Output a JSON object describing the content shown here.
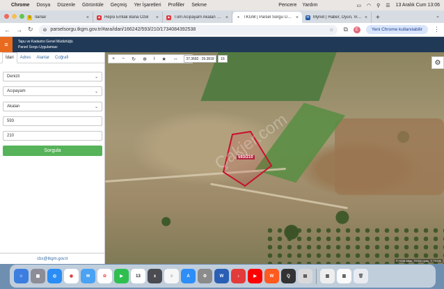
{
  "menubar": {
    "app": "Chrome",
    "items": [
      "Dosya",
      "Düzenle",
      "Görüntüle",
      "Geçmiş",
      "Yer İşaretleri",
      "Profiller",
      "Sekme"
    ],
    "right_items": [
      "Pencere",
      "Yardım"
    ],
    "datetime": "13 Aralık Cum 13:06"
  },
  "tabs": [
    {
      "title": "İlanlar",
      "fav_text": "S",
      "fav_color": "#f2c200"
    },
    {
      "title": "Hepsi Emlak Bana Özel",
      "fav_text": "",
      "fav_color": "#e0393e"
    },
    {
      "title": "Tüm Acıpayam Akalan Mh. İl...",
      "fav_text": "",
      "fav_color": "#e0393e"
    },
    {
      "title": "TKGM | Parsel Sorgu Uygulam...",
      "fav_text": "",
      "fav_color": "#555555",
      "active": true
    },
    {
      "title": "Mynet | Haber, Oyun, Video, ...",
      "fav_text": "",
      "fav_color": "#1e5aa8"
    }
  ],
  "address": {
    "url": "parselsorgu.tkgm.gov.tr/#ara/idari/166242/593/210/1734084392538",
    "profile_initial": "E",
    "update_label": "Yeni Chrome kullanılabilir"
  },
  "site": {
    "title_line1": "Tapu ve Kadastro Genel Müdürlüğü",
    "title_line2": "Parsel Sorgu Uygulaması"
  },
  "panel": {
    "tabs": [
      "İdari",
      "Adres",
      "Ada/Parsel",
      "Coğrafi"
    ],
    "tabs_display": [
      "İdari",
      "Adres",
      "Alanlar",
      "Coğrafi"
    ],
    "province": "Denizli",
    "district": "Acıpayam",
    "neighborhood": "Akalan",
    "ada": "593",
    "parsel": "210",
    "query_label": "Sorgula",
    "footer_email": "cbs@tkgm.gov.tr"
  },
  "map": {
    "coords": "37.3682 : 29.3818",
    "zoom": "16",
    "parcel_label": "593/210",
    "watermark": "Çakjer.com",
    "attribution": "© HGM Atlas, TKGM Uydu, © TKGM"
  },
  "colors": {
    "header": "#1f3957",
    "accent_orange": "#e86a1f",
    "query_green": "#57b35a",
    "parcel_outline": "#c8102e"
  }
}
